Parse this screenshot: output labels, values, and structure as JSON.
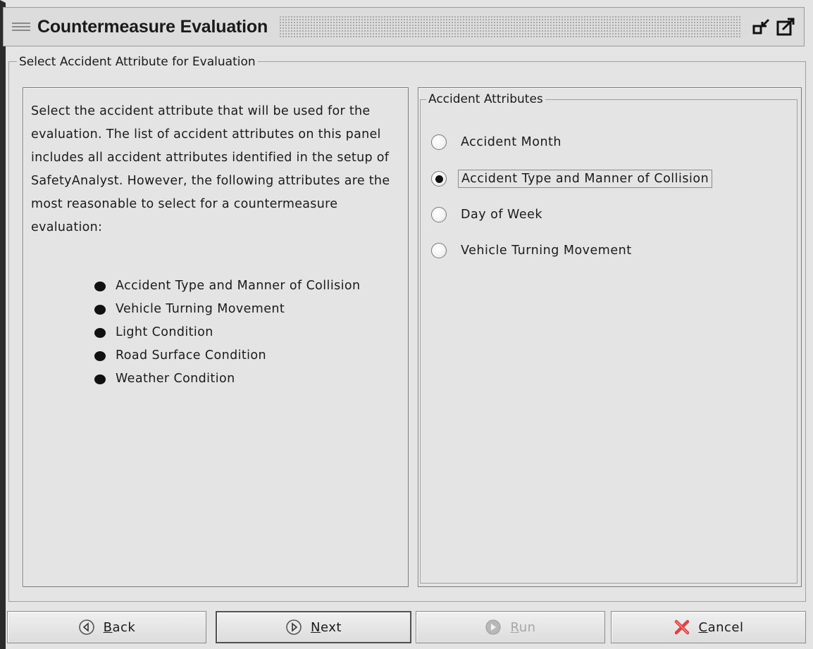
{
  "window": {
    "title": "Countermeasure Evaluation"
  },
  "main": {
    "group_title": "Select Accident Attribute for Evaluation",
    "info": {
      "paragraph": "Select the accident attribute that will be used for the evaluation. The list of accident attributes on this panel includes all accident attributes identified in the setup of SafetyAnalyst. However, the following attributes are the most reasonable to select for a countermeasure evaluation:",
      "bullets": [
        "Accident Type and Manner of Collision",
        "Vehicle Turning Movement",
        "Light Condition",
        "Road Surface Condition",
        "Weather Condition"
      ]
    },
    "attributes": {
      "title": "Accident Attributes",
      "options": [
        {
          "label": "Accident Month",
          "selected": false
        },
        {
          "label": "Accident Type and Manner of Collision",
          "selected": true
        },
        {
          "label": "Day of Week",
          "selected": false
        },
        {
          "label": "Vehicle Turning Movement",
          "selected": false
        }
      ]
    }
  },
  "buttons": {
    "back": {
      "mnemonic": "B",
      "rest": "ack",
      "icon": "arrow-left-circle-icon"
    },
    "next": {
      "mnemonic": "N",
      "rest": "ext",
      "icon": "arrow-right-circle-icon"
    },
    "run": {
      "mnemonic": "R",
      "rest": "un",
      "icon": "run-disabled-icon",
      "disabled": true
    },
    "cancel": {
      "mnemonic": "C",
      "rest": "ancel",
      "icon": "red-x-icon"
    }
  },
  "colors": {
    "window_bg": "#e4e4e4",
    "cancel_icon": "#e04040",
    "disabled_text": "#a6a6a6"
  }
}
